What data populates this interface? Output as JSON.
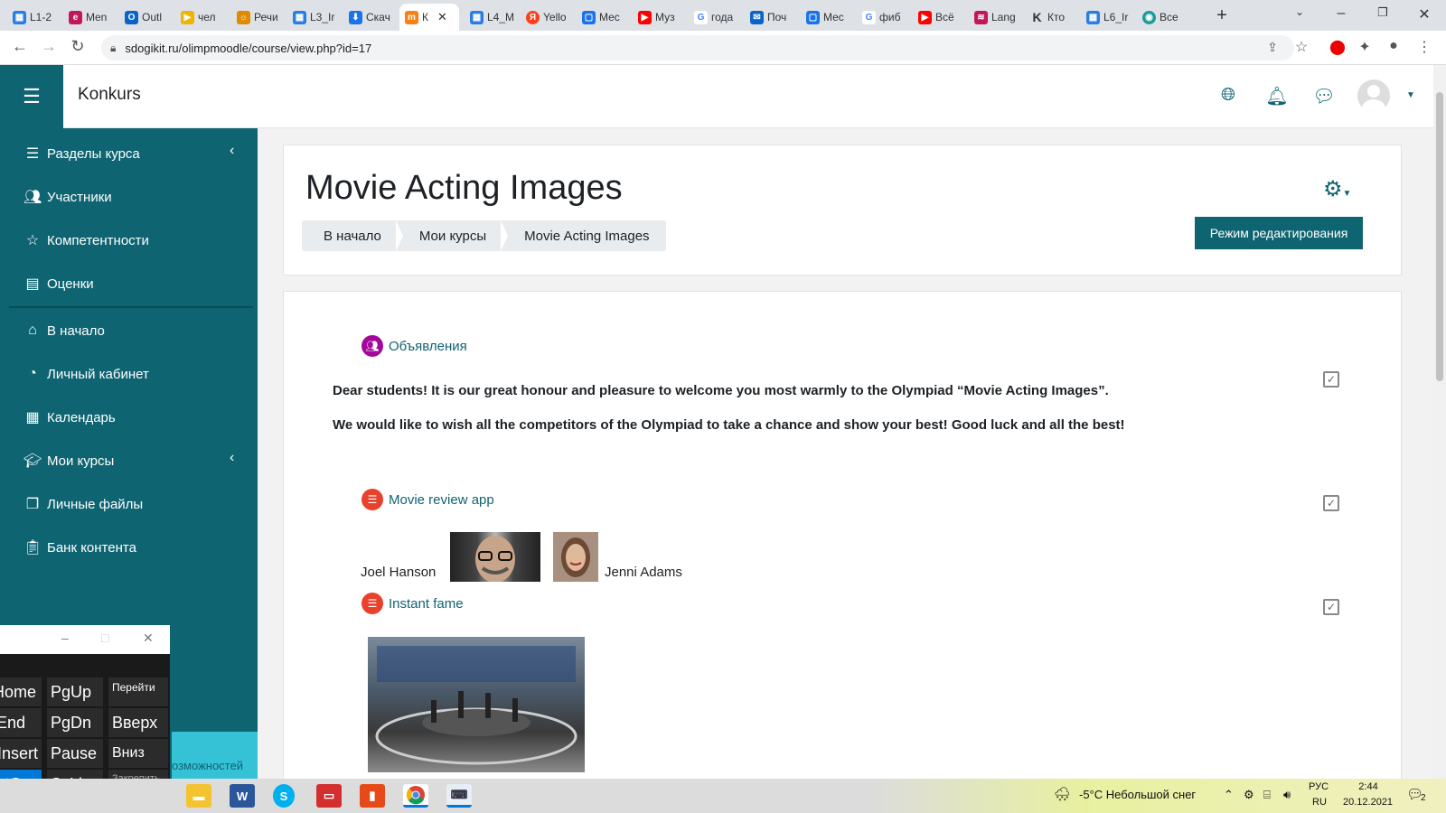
{
  "browser": {
    "tabs": [
      {
        "label": "L1-2",
        "icon": "grid-icon",
        "color": "#2a7de1"
      },
      {
        "label": "Men",
        "icon": "e-icon",
        "color": "#c2185b"
      },
      {
        "label": "Outl",
        "icon": "outlook-icon",
        "color": "#0a64c8"
      },
      {
        "label": "чел",
        "icon": "play-icon",
        "color": "#f0b400"
      },
      {
        "label": "Речи",
        "icon": "sun-icon",
        "color": "#e08a00"
      },
      {
        "label": "L3_Ir",
        "icon": "grid-icon",
        "color": "#2a7de1"
      },
      {
        "label": "Скач",
        "icon": "download-icon",
        "color": "#1a73e8"
      },
      {
        "label": "К",
        "icon": "moodle-icon",
        "color": "#f98012"
      },
      {
        "label": "L4_M",
        "icon": "grid-icon",
        "color": "#2a7de1"
      },
      {
        "label": "Yello",
        "icon": "yandex-icon",
        "color": "#fc3f1d"
      },
      {
        "label": "Мес",
        "icon": "messenger-icon",
        "color": "#1a73e8"
      },
      {
        "label": "Муз",
        "icon": "youtube-icon",
        "color": "#ff0000"
      },
      {
        "label": "года",
        "icon": "google-icon",
        "color": "#4285f4"
      },
      {
        "label": "Поч",
        "icon": "mail-icon",
        "color": "#0a64c8"
      },
      {
        "label": "Мес",
        "icon": "messenger-icon",
        "color": "#1a73e8"
      },
      {
        "label": "фиб",
        "icon": "google-icon",
        "color": "#4285f4"
      },
      {
        "label": "Всё",
        "icon": "youtube-icon",
        "color": "#ff0000"
      },
      {
        "label": "Lang",
        "icon": "lang-icon",
        "color": "#c2185b"
      },
      {
        "label": "Кто",
        "icon": "k-icon",
        "color": "#333333"
      },
      {
        "label": "L6_Ir",
        "icon": "grid-icon",
        "color": "#2a7de1"
      },
      {
        "label": "Все",
        "icon": "eye-icon",
        "color": "#1a9a9a"
      }
    ],
    "url": "sdogikit.ru/olimpmoodle/course/view.php?id=17"
  },
  "header": {
    "site_name": "Konkurs"
  },
  "sidebar": {
    "items": [
      {
        "label": "Разделы курса",
        "icon": "list-icon"
      },
      {
        "label": "Участники",
        "icon": "users-icon"
      },
      {
        "label": "Компетентности",
        "icon": "star-icon"
      },
      {
        "label": "Оценки",
        "icon": "grades-icon"
      },
      {
        "label": "В начало",
        "icon": "home-icon"
      },
      {
        "label": "Личный кабинет",
        "icon": "dashboard-icon"
      },
      {
        "label": "Календарь",
        "icon": "calendar-icon"
      },
      {
        "label": "Мои курсы",
        "icon": "graduation-cap-icon"
      },
      {
        "label": "Личные файлы",
        "icon": "files-icon"
      },
      {
        "label": "Банк контента",
        "icon": "clipboard-icon"
      }
    ],
    "bottom_text": "озможностей"
  },
  "course": {
    "title": "Movie Acting Images",
    "breadcrumbs": [
      "В начало",
      "Мои курсы",
      "Movie Acting Images"
    ],
    "edit_button": "Режим редактирования"
  },
  "activities": {
    "announcements": "Объявления",
    "welcome_line1": "Dear students!  It is our great honour and pleasure to welcome you most warmly to the Olympiad “Movie Acting Images”.",
    "welcome_line2": "We would like to wish all the competitors of the Olympiad to take a chance and show your best! Good luck and all the best!",
    "movie_review": "Movie review app",
    "person1": "Joel Hanson",
    "person2": "Jenni Adams",
    "instant_fame": "Instant fame"
  },
  "keyboard": {
    "keys": [
      {
        "label": "Home"
      },
      {
        "label": "PgUp"
      },
      {
        "label": "Перейти"
      },
      {
        "label": "End"
      },
      {
        "label": "PgDn"
      },
      {
        "label": "Вверх"
      },
      {
        "label": "Insert"
      },
      {
        "label": "Pause"
      },
      {
        "label": "Вниз"
      },
      {
        "label": "PrtScn"
      },
      {
        "label": "ScLk"
      },
      {
        "label": "Закрепить"
      }
    ]
  },
  "taskbar": {
    "weather": "-5°C  Небольшой снег",
    "lang_top": "РУС",
    "lang_bottom": "RU",
    "time": "2:44",
    "date": "20.12.2021",
    "notifications": "2"
  },
  "colors": {
    "brand": "#0f6472",
    "accent_red": "#e8412c",
    "accent_purple": "#a3089d"
  }
}
